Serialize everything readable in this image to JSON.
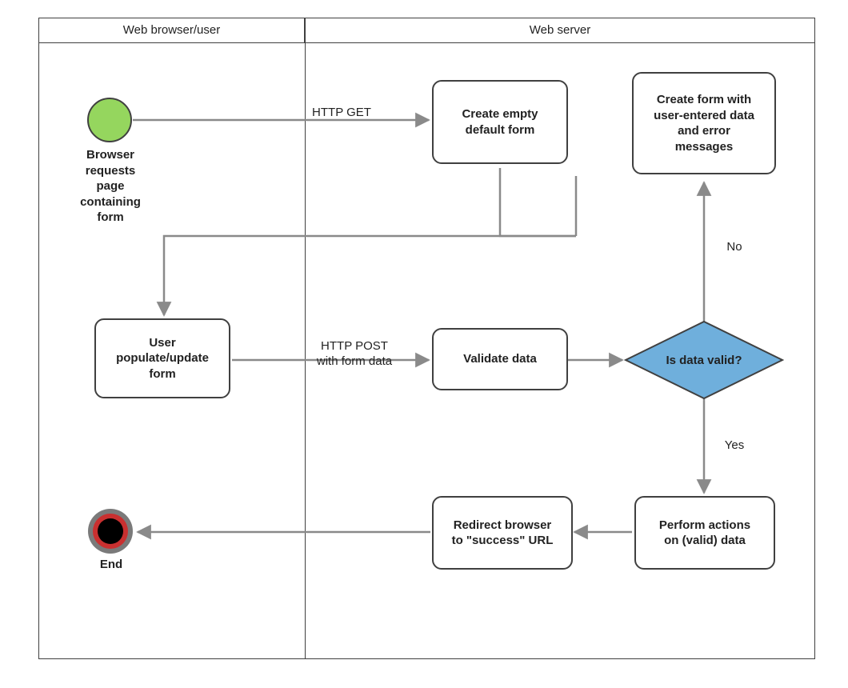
{
  "lanes": {
    "browser": "Web browser/user",
    "server": "Web server"
  },
  "nodes": {
    "start_caption": "Browser\nrequests\npage\ncontaining\nform",
    "create_empty": "Create empty\ndefault form",
    "create_error": "Create form with\nuser-entered data\nand error\nmessages",
    "user_populate": "User\npopulate/update\nform",
    "validate": "Validate data",
    "decision": "Is data valid?",
    "perform": "Perform actions\non (valid) data",
    "redirect": "Redirect browser\nto \"success\" URL",
    "end_caption": "End"
  },
  "edges": {
    "http_get": "HTTP GET",
    "http_post": "HTTP POST\nwith form data",
    "no": "No",
    "yes": "Yes"
  }
}
